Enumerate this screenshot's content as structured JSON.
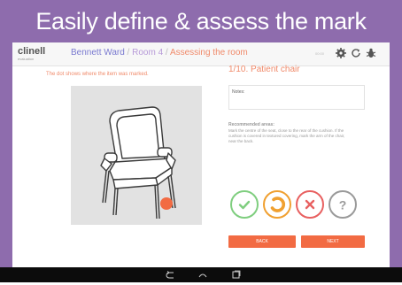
{
  "banner": {
    "title": "Easily define & assess the mark"
  },
  "app": {
    "logo_name": "clinell",
    "logo_sub": "evaluation",
    "breadcrumb": {
      "ward": "Bennett Ward",
      "sep": " / ",
      "room": "Room 4",
      "current": "Assessing the room"
    },
    "meta_text": "00:00"
  },
  "main": {
    "hint": "The dot shows where the item was marked.",
    "item_title": "1/10. Patient chair",
    "notes_label": "Notes:",
    "recommended_title": "Recommended areas:",
    "recommended_body": "Mark the centre of the seat, close to the rear of the cushion. If the cushion is covered in textured covering, mark the arm of the chair, near the back."
  },
  "actions": {
    "back": "BACK",
    "next": "NEXT"
  },
  "colors": {
    "accent": "#f26b43",
    "banner": "#8e6cad",
    "pass": "#7fce7f",
    "partial": "#f0a030",
    "fail": "#e86060",
    "unknown": "#9a9a9a"
  },
  "icons": [
    "settings-icon",
    "refresh-icon",
    "bug-icon",
    "pass-icon",
    "partial-icon",
    "fail-icon",
    "unknown-icon",
    "android-back-icon",
    "android-home-icon",
    "android-recents-icon"
  ]
}
